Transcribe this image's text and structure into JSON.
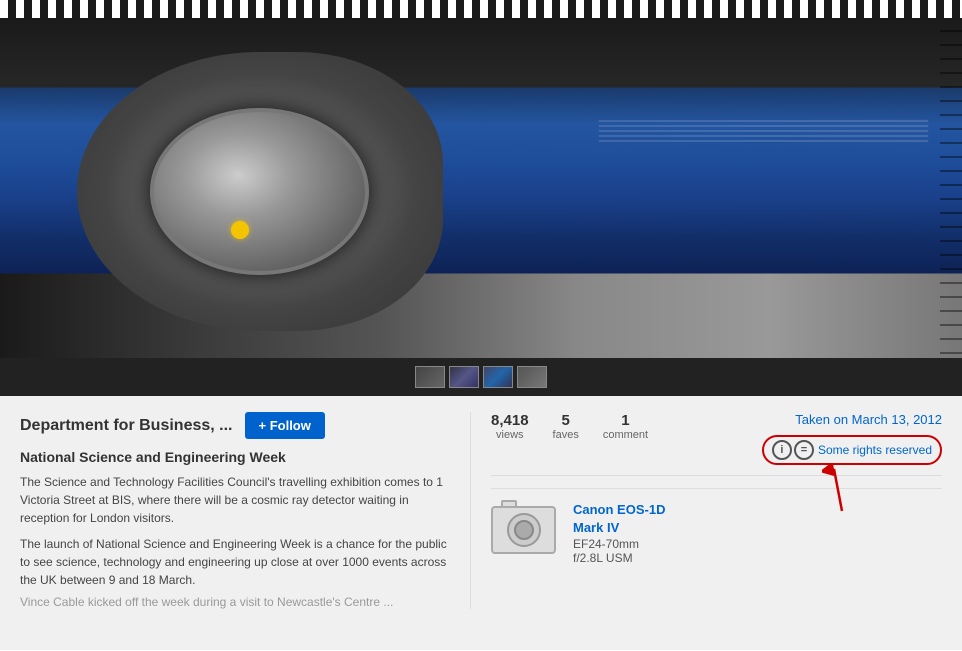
{
  "photo": {
    "image_alt": "CERN LHC tunnel with cosmic ray detector",
    "thumbnails": [
      {
        "label": "thumb1"
      },
      {
        "label": "thumb2"
      },
      {
        "label": "thumb3"
      },
      {
        "label": "thumb4"
      }
    ]
  },
  "author": {
    "name": "Department for Business, ...",
    "follow_label": "+ Follow"
  },
  "photo_title": "National Science and Engineering Week",
  "description_part1": "The Science and Technology Facilities Council's travelling exhibition comes to 1 Victoria Street at BIS, where there will be a cosmic ray detector waiting in reception for London visitors.",
  "description_part2": "The launch of National Science and Engineering Week is a chance for the public to see science, technology and engineering up close at over 1000 events across the UK between 9 and 18 March.",
  "description_faded": "Vince Cable kicked off the week during a visit to Newcastle's Centre ...",
  "stats": {
    "views_value": "8,418",
    "views_label": "views",
    "faves_value": "5",
    "faves_label": "faves",
    "comment_value": "1",
    "comment_label": "comment"
  },
  "taken_on": "Taken on March 13, 2012",
  "license": {
    "text": "Some rights reserved",
    "icon_i": "i",
    "icon_eq": "="
  },
  "camera": {
    "model_line1": "Canon EOS-1D",
    "model_line2": "Mark IV",
    "lens_focal": "EF24-70mm",
    "lens_aperture": "f/2.8L USM"
  },
  "colors": {
    "follow_button_bg": "#0062cc",
    "link_color": "#0066cc",
    "license_highlight": "#cc0000",
    "text_dark": "#333333",
    "text_light": "#666666"
  }
}
